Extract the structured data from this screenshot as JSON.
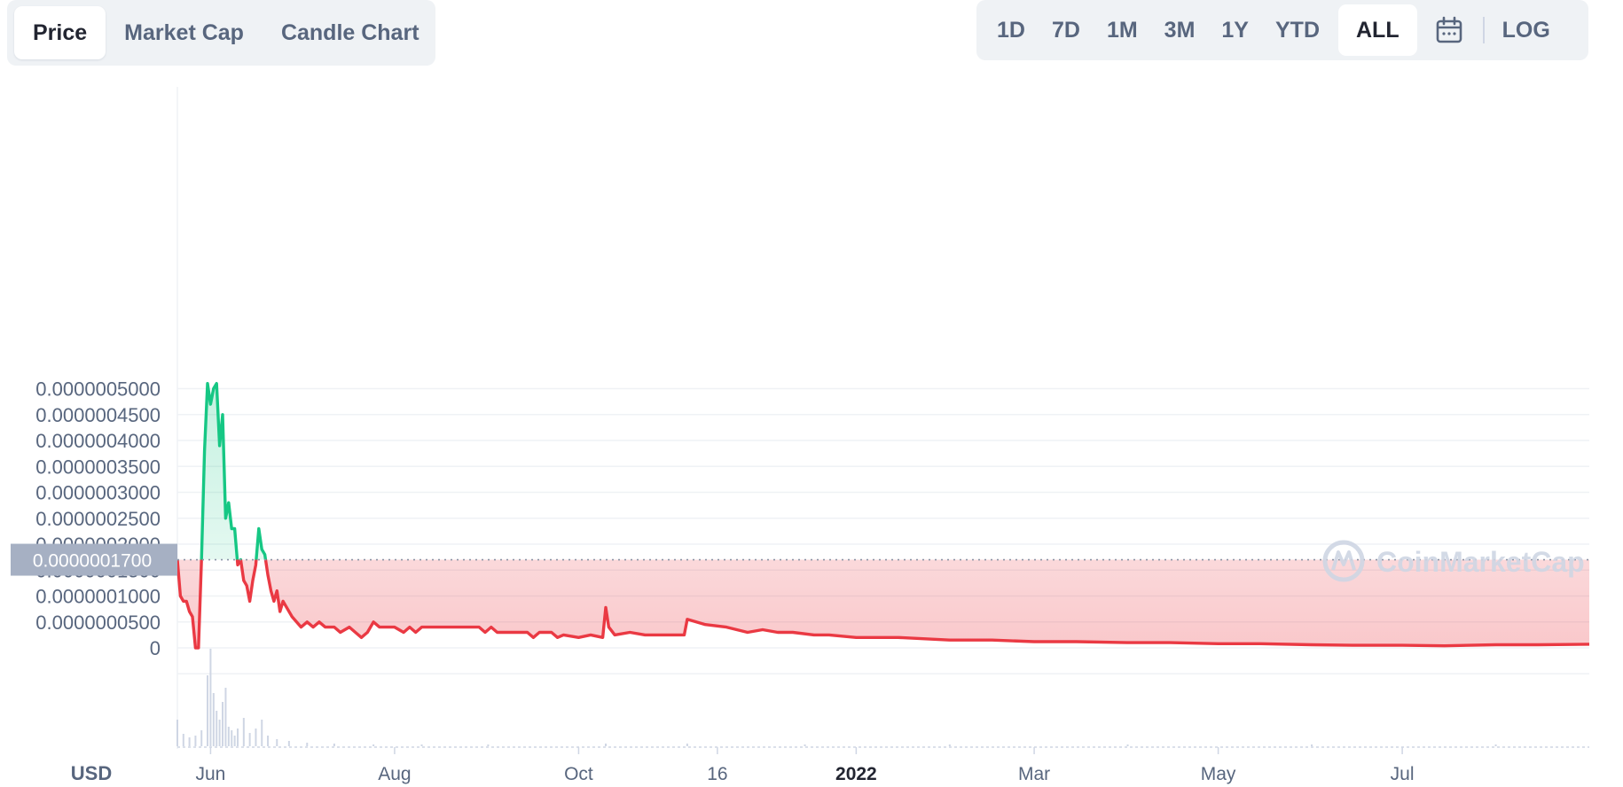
{
  "tabs": [
    {
      "label": "Price",
      "active": true
    },
    {
      "label": "Market Cap",
      "active": false
    },
    {
      "label": "Candle Chart",
      "active": false
    }
  ],
  "ranges": [
    {
      "label": "1D",
      "active": false
    },
    {
      "label": "7D",
      "active": false
    },
    {
      "label": "1M",
      "active": false
    },
    {
      "label": "3M",
      "active": false
    },
    {
      "label": "1Y",
      "active": false
    },
    {
      "label": "YTD",
      "active": false
    },
    {
      "label": "ALL",
      "active": true
    }
  ],
  "calendar_icon": "calendar-icon",
  "log_label": "LOG",
  "currency_label": "USD",
  "watermark": "CoinMarketCap",
  "current_price_label": "0.0000001700",
  "colors": {
    "up": "#16c784",
    "down": "#ea3943",
    "grid": "#eff2f5",
    "axis_text": "#58667e",
    "price_tag_bg": "#a6b0c3",
    "volume": "#cfd6e4"
  },
  "chart_data": {
    "type": "line",
    "xlabel": "",
    "ylabel": "",
    "ylim": [
      0,
      5.5e-07
    ],
    "y_ticks": [
      "0",
      "0.0000000500",
      "0.0000001000",
      "0.0000001500",
      "0.0000002000",
      "0.0000002500",
      "0.0000003000",
      "0.0000003500",
      "0.0000004000",
      "0.0000004500",
      "0.0000005000"
    ],
    "x_ticks": [
      {
        "label": "Jun",
        "date": "2021-06-01",
        "bold": false
      },
      {
        "label": "Aug",
        "date": "2021-08-01",
        "bold": false
      },
      {
        "label": "Oct",
        "date": "2021-10-01",
        "bold": false
      },
      {
        "label": "16",
        "date": "2021-11-16",
        "bold": false
      },
      {
        "label": "2022",
        "date": "2022-01-01",
        "bold": true
      },
      {
        "label": "Mar",
        "date": "2022-03-01",
        "bold": false
      },
      {
        "label": "May",
        "date": "2022-05-01",
        "bold": false
      },
      {
        "label": "Jul",
        "date": "2022-07-01",
        "bold": false
      }
    ],
    "baseline": 1.7e-07,
    "series": [
      {
        "values": [
          [
            "2021-05-21",
            1.7e-07
          ],
          [
            "2021-05-22",
            1e-07
          ],
          [
            "2021-05-23",
            9e-08
          ],
          [
            "2021-05-24",
            9e-08
          ],
          [
            "2021-05-25",
            7e-08
          ],
          [
            "2021-05-26",
            6e-08
          ],
          [
            "2021-05-27",
            0.0
          ],
          [
            "2021-05-28",
            0.0
          ],
          [
            "2021-05-29",
            1.7e-07
          ],
          [
            "2021-05-30",
            3.8e-07
          ],
          [
            "2021-05-31",
            5.1e-07
          ],
          [
            "2021-06-01",
            4.7e-07
          ],
          [
            "2021-06-02",
            5e-07
          ],
          [
            "2021-06-03",
            5.1e-07
          ],
          [
            "2021-06-04",
            3.9e-07
          ],
          [
            "2021-06-05",
            4.5e-07
          ],
          [
            "2021-06-06",
            2.5e-07
          ],
          [
            "2021-06-07",
            2.8e-07
          ],
          [
            "2021-06-08",
            2.3e-07
          ],
          [
            "2021-06-09",
            2.3e-07
          ],
          [
            "2021-06-10",
            1.6e-07
          ],
          [
            "2021-06-11",
            1.7e-07
          ],
          [
            "2021-06-12",
            1.3e-07
          ],
          [
            "2021-06-13",
            1.2e-07
          ],
          [
            "2021-06-14",
            9e-08
          ],
          [
            "2021-06-15",
            1.3e-07
          ],
          [
            "2021-06-16",
            1.6e-07
          ],
          [
            "2021-06-17",
            2.3e-07
          ],
          [
            "2021-06-18",
            1.9e-07
          ],
          [
            "2021-06-19",
            1.8e-07
          ],
          [
            "2021-06-20",
            1.4e-07
          ],
          [
            "2021-06-21",
            1.1e-07
          ],
          [
            "2021-06-22",
            9e-08
          ],
          [
            "2021-06-23",
            1.1e-07
          ],
          [
            "2021-06-24",
            7e-08
          ],
          [
            "2021-06-25",
            9e-08
          ],
          [
            "2021-06-26",
            8e-08
          ],
          [
            "2021-06-28",
            6e-08
          ],
          [
            "2021-07-01",
            4e-08
          ],
          [
            "2021-07-03",
            5e-08
          ],
          [
            "2021-07-05",
            4e-08
          ],
          [
            "2021-07-07",
            5e-08
          ],
          [
            "2021-07-09",
            4e-08
          ],
          [
            "2021-07-12",
            4e-08
          ],
          [
            "2021-07-14",
            3e-08
          ],
          [
            "2021-07-17",
            4e-08
          ],
          [
            "2021-07-19",
            3e-08
          ],
          [
            "2021-07-21",
            2e-08
          ],
          [
            "2021-07-23",
            3e-08
          ],
          [
            "2021-07-25",
            5e-08
          ],
          [
            "2021-07-27",
            4e-08
          ],
          [
            "2021-08-01",
            4e-08
          ],
          [
            "2021-08-04",
            3e-08
          ],
          [
            "2021-08-06",
            4e-08
          ],
          [
            "2021-08-08",
            3e-08
          ],
          [
            "2021-08-10",
            4e-08
          ],
          [
            "2021-08-20",
            4e-08
          ],
          [
            "2021-08-29",
            4e-08
          ],
          [
            "2021-08-31",
            3e-08
          ],
          [
            "2021-09-02",
            4e-08
          ],
          [
            "2021-09-04",
            3e-08
          ],
          [
            "2021-09-12",
            3e-08
          ],
          [
            "2021-09-14",
            3e-08
          ],
          [
            "2021-09-16",
            2e-08
          ],
          [
            "2021-09-18",
            3e-08
          ],
          [
            "2021-09-22",
            3e-08
          ],
          [
            "2021-09-24",
            2e-08
          ],
          [
            "2021-09-26",
            2.5e-08
          ],
          [
            "2021-10-01",
            2e-08
          ],
          [
            "2021-10-05",
            2.5e-08
          ],
          [
            "2021-10-09",
            2e-08
          ],
          [
            "2021-10-10",
            7.8e-08
          ],
          [
            "2021-10-11",
            4e-08
          ],
          [
            "2021-10-13",
            2.5e-08
          ],
          [
            "2021-10-18",
            3e-08
          ],
          [
            "2021-10-23",
            2.5e-08
          ],
          [
            "2021-11-01",
            2.5e-08
          ],
          [
            "2021-11-05",
            2.5e-08
          ],
          [
            "2021-11-06",
            5.5e-08
          ],
          [
            "2021-11-09",
            5e-08
          ],
          [
            "2021-11-12",
            4.5e-08
          ],
          [
            "2021-11-19",
            4e-08
          ],
          [
            "2021-11-26",
            3e-08
          ],
          [
            "2021-12-01",
            3.5e-08
          ],
          [
            "2021-12-06",
            3e-08
          ],
          [
            "2021-12-11",
            3e-08
          ],
          [
            "2021-12-18",
            2.5e-08
          ],
          [
            "2021-12-23",
            2.5e-08
          ],
          [
            "2022-01-01",
            2e-08
          ],
          [
            "2022-01-15",
            2e-08
          ],
          [
            "2022-02-01",
            1.5e-08
          ],
          [
            "2022-02-15",
            1.5e-08
          ],
          [
            "2022-03-01",
            1.2e-08
          ],
          [
            "2022-03-15",
            1.2e-08
          ],
          [
            "2022-04-01",
            1e-08
          ],
          [
            "2022-04-15",
            1e-08
          ],
          [
            "2022-05-01",
            8e-09
          ],
          [
            "2022-05-15",
            8e-09
          ],
          [
            "2022-06-01",
            6e-09
          ],
          [
            "2022-06-15",
            5e-09
          ],
          [
            "2022-07-01",
            5e-09
          ],
          [
            "2022-07-15",
            4e-09
          ],
          [
            "2022-08-01",
            6e-09
          ],
          [
            "2022-08-15",
            6e-09
          ],
          [
            "2022-09-01",
            7e-09
          ]
        ]
      }
    ]
  }
}
